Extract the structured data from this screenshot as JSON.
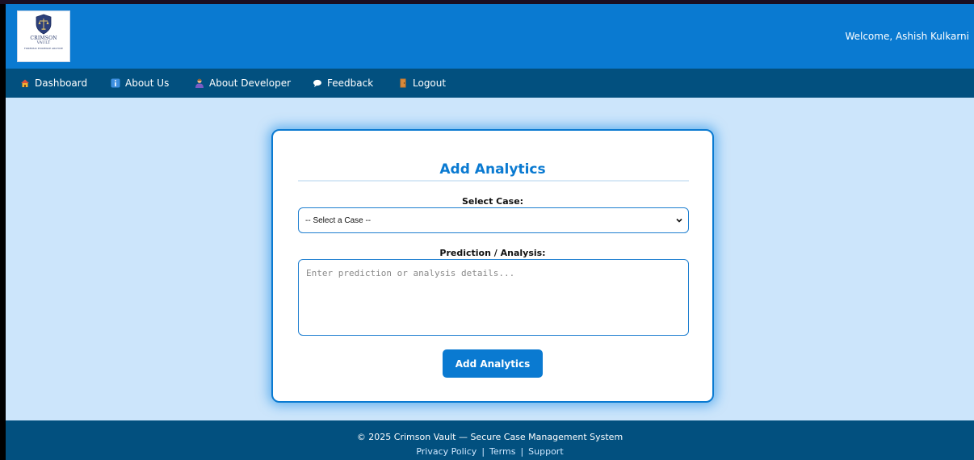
{
  "header": {
    "logo_text": [
      "CRIMSON",
      "VAULT",
      "FORENSIC EVIDENCE ARCHIVE"
    ],
    "welcome_text": "Welcome, Ashish Kulkarni"
  },
  "nav": {
    "items": [
      {
        "label": "Dashboard",
        "icon": "house-icon"
      },
      {
        "label": "About Us",
        "icon": "info-icon"
      },
      {
        "label": "About Developer",
        "icon": "person-icon"
      },
      {
        "label": "Feedback",
        "icon": "speech-bubble-icon"
      },
      {
        "label": "Logout",
        "icon": "door-icon"
      }
    ]
  },
  "form": {
    "title": "Add Analytics",
    "case_label": "Select Case:",
    "case_selected": "-- Select a Case --",
    "prediction_label": "Prediction / Analysis:",
    "prediction_placeholder": "Enter prediction or analysis details...",
    "prediction_value": "",
    "submit_label": "Add Analytics"
  },
  "footer": {
    "copyright": "© 2025 Crimson Vault — Secure Case Management System",
    "links": [
      "Privacy Policy",
      "Terms",
      "Support"
    ],
    "separator": "|"
  },
  "colors": {
    "header_blue": "#0a7ad1",
    "nav_dark_blue": "#02507f",
    "page_background": "#cce5fb",
    "accent": "#0a7ad1"
  }
}
